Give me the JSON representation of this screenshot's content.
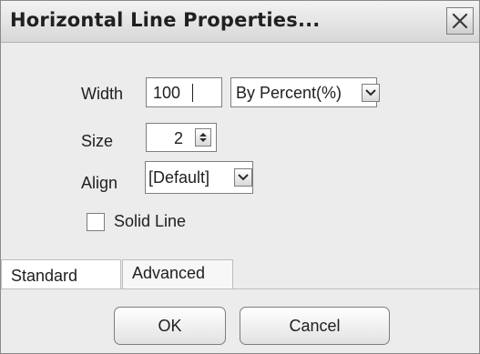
{
  "window": {
    "title": "Horizontal Line Properties..."
  },
  "width": {
    "label": "Width",
    "value": "100",
    "unit": "By Percent(%)"
  },
  "size": {
    "label": "Size",
    "value": "2"
  },
  "align": {
    "label": "Align",
    "value": "[Default]"
  },
  "solid_line": {
    "label": "Solid Line",
    "checked": false
  },
  "tabs": [
    {
      "label": "Standard",
      "selected": true
    },
    {
      "label": "Advanced",
      "selected": false
    }
  ],
  "buttons": {
    "ok": "OK",
    "cancel": "Cancel"
  },
  "icons": {
    "close": "close-icon",
    "dropdown": "chevron-down-icon",
    "spinner": "spinner-icon"
  }
}
